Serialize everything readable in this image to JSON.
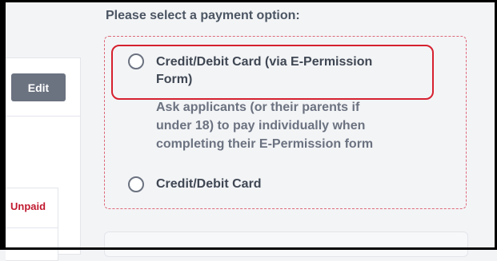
{
  "left_panel": {
    "edit_label": "Edit",
    "status_label": "Unpaid"
  },
  "payment": {
    "heading": "Please select a payment option:",
    "options": [
      {
        "label": "Credit/Debit Card (via E-Permission Form)",
        "label_line1": "Credit/Debit Card (via E-Permission",
        "label_line2": "Form)",
        "description_line1": "Ask applicants (or their parents if",
        "description_line2": "under 18) to pay individually when",
        "description_line3": "completing their E-Permission form",
        "selected": false,
        "highlighted": true
      },
      {
        "label": "Credit/Debit Card",
        "selected": false,
        "highlighted": false
      }
    ]
  },
  "colors": {
    "highlight_border": "#d6212f",
    "dashed_border": "#de6a7a",
    "unpaid_text": "#c0192e",
    "button_bg": "#6b7280"
  }
}
